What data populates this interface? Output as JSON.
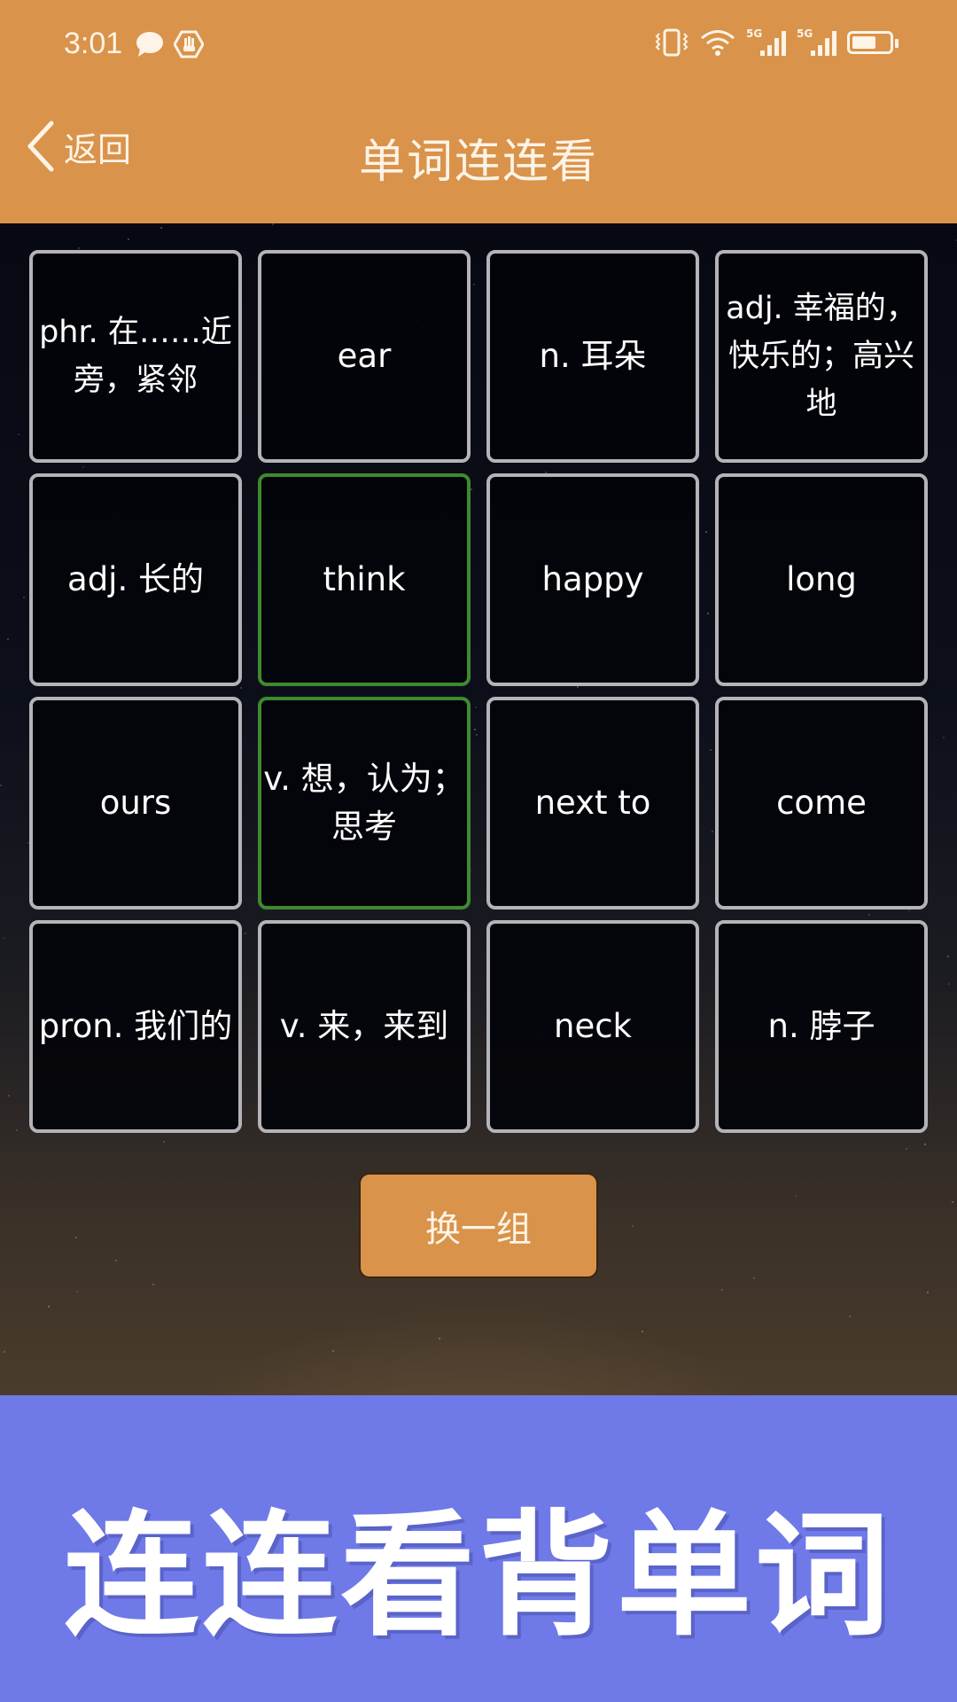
{
  "status_bar": {
    "time": "3:01",
    "left_icons": [
      "message-icon",
      "hand-icon"
    ],
    "right_icons": [
      "vibrate-icon",
      "wifi-icon",
      "signal-5g-1-icon",
      "signal-5g-2-icon",
      "battery-icon"
    ],
    "network_label_1": "5G",
    "network_label_2": "5G",
    "battery_level": 0.65
  },
  "header": {
    "back_label": "返回",
    "title": "单词连连看"
  },
  "theme": {
    "accent": "#d9934a",
    "card_border": "#b3b3b8",
    "selected_border": "#3f8a2e",
    "banner": "#6f7ae8"
  },
  "cards": [
    {
      "text": "phr. 在……近旁，紧邻",
      "selected": false
    },
    {
      "text": "ear",
      "selected": false
    },
    {
      "text": "n. 耳朵",
      "selected": false
    },
    {
      "text": "adj. 幸福的，快乐的；高兴地",
      "selected": false
    },
    {
      "text": "adj. 长的",
      "selected": false
    },
    {
      "text": "think",
      "selected": true
    },
    {
      "text": "happy",
      "selected": false
    },
    {
      "text": "long",
      "selected": false
    },
    {
      "text": "ours",
      "selected": false
    },
    {
      "text": "v. 想，认为；思考",
      "selected": true
    },
    {
      "text": "next to",
      "selected": false
    },
    {
      "text": "come",
      "selected": false
    },
    {
      "text": "pron. 我们的",
      "selected": false
    },
    {
      "text": "v. 来，来到",
      "selected": false
    },
    {
      "text": "neck",
      "selected": false
    },
    {
      "text": "n. 脖子",
      "selected": false
    }
  ],
  "swap_button_label": "换一组",
  "banner_text": "连连看背单词"
}
